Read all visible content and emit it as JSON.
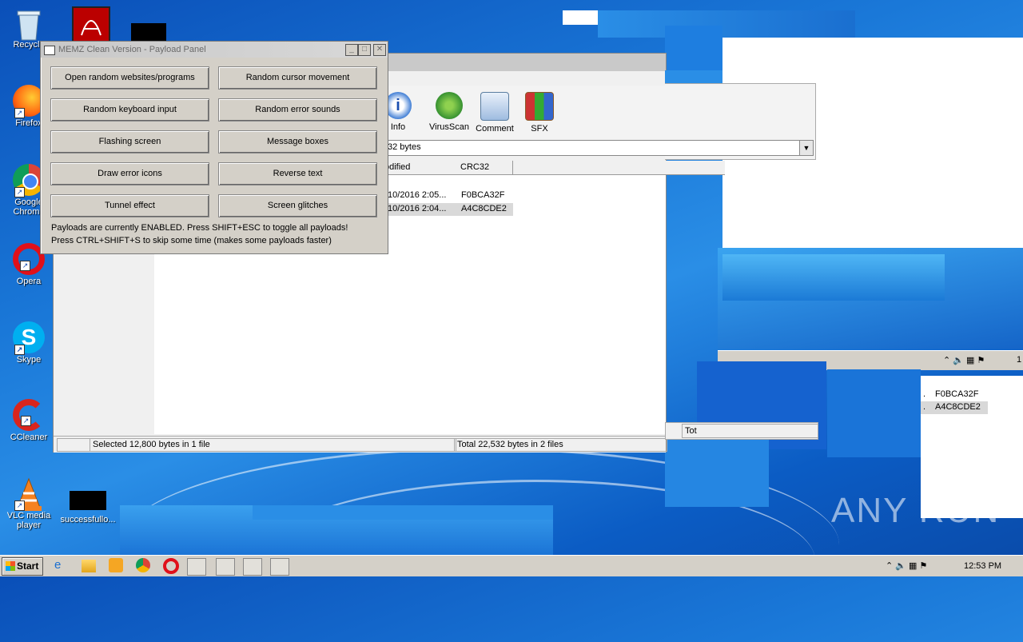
{
  "desktop": {
    "icons": [
      {
        "label": "Recycle"
      },
      {
        "label": "Firefox"
      },
      {
        "label": "Google Chrome"
      },
      {
        "label": "Opera"
      },
      {
        "label": "Skype"
      },
      {
        "label": "CCleaner"
      },
      {
        "label": "VLC media player"
      },
      {
        "label": "successfullo..."
      }
    ]
  },
  "memz": {
    "title": "MEMZ Clean Version - Payload Panel",
    "buttons": [
      "Open random websites/programs",
      "Random cursor movement",
      "Random keyboard input",
      "Random error sounds",
      "Flashing screen",
      "Message boxes",
      "Draw error icons",
      "Reverse text",
      "Tunnel effect",
      "Screen glitches"
    ],
    "note1": "Payloads are currently ENABLED. Press SHIFT+ESC to toggle all payloads!",
    "note2": "Press CTRL+SHIFT+S to skip some time (makes some payloads faster)",
    "minimize_glyph": "_",
    "maximize_glyph": "□",
    "close_glyph": "✕"
  },
  "winrar": {
    "toolbar": [
      "Info",
      "VirusScan",
      "Comment",
      "SFX"
    ],
    "path_value": "32 bytes",
    "columns": [
      "odified",
      "CRC32"
    ],
    "rows": [
      {
        "modified": "/10/2016 2:05...",
        "crc": "F0BCA32F"
      },
      {
        "modified": "/10/2016 2:04...",
        "crc": "A4C8CDE2"
      }
    ],
    "status_left": "Selected 12,800 bytes in 1 file",
    "status_right": "Total 22,532 bytes in 2 files",
    "status_fragment": "Tot",
    "dup_rows": [
      {
        "prefix": ".",
        "crc": "F0BCA32F"
      },
      {
        "prefix": ".",
        "crc": "A4C8CDE2"
      }
    ],
    "tray_fragment": "1"
  },
  "taskbar": {
    "start_label": "Start",
    "clock": "12:53 PM"
  },
  "watermark": "ANY RUN",
  "colors": {
    "desktop": "#1a78d8",
    "selection": "#cde0f5",
    "dialog": "#d4d0c8"
  }
}
